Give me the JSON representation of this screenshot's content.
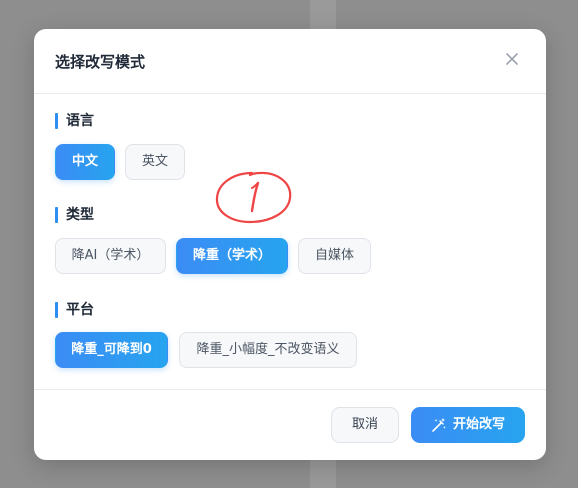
{
  "modal": {
    "title": "选择改写模式",
    "close_icon": "close-icon"
  },
  "sections": {
    "language": {
      "label": "语言",
      "options": [
        {
          "label": "中文",
          "selected": true
        },
        {
          "label": "英文",
          "selected": false
        }
      ]
    },
    "type": {
      "label": "类型",
      "options": [
        {
          "label": "降AI（学术）",
          "selected": false
        },
        {
          "label": "降重（学术）",
          "selected": true
        },
        {
          "label": "自媒体",
          "selected": false
        }
      ]
    },
    "platform": {
      "label": "平台",
      "options": [
        {
          "label": "降重_可降到0",
          "selected": true
        },
        {
          "label": "降重_小幅度_不改变语义",
          "selected": false
        }
      ]
    }
  },
  "footer": {
    "cancel_label": "取消",
    "start_label": "开始改写",
    "start_icon": "magic-wand-icon"
  },
  "colors": {
    "accent_start": "#3b8cf5",
    "accent_end": "#27a4ef",
    "annotation": "#ef4444"
  }
}
